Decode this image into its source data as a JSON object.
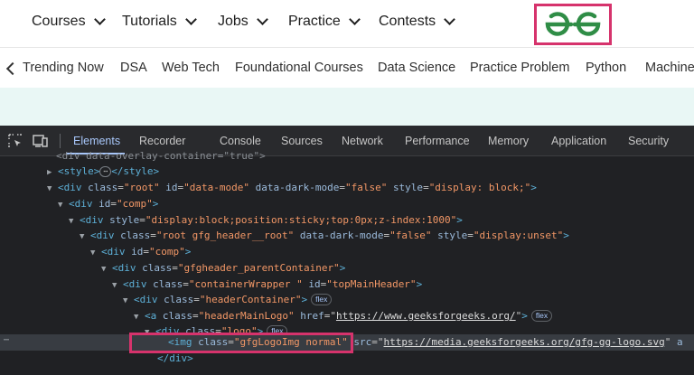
{
  "top_nav": {
    "items": [
      {
        "label": "Courses"
      },
      {
        "label": "Tutorials"
      },
      {
        "label": "Jobs"
      },
      {
        "label": "Practice"
      },
      {
        "label": "Contests"
      }
    ],
    "logo_text": "GfG",
    "logo_color": "#2f8d46",
    "highlight_color": "#d6336c"
  },
  "sub_nav": {
    "items": [
      {
        "label": "Trending Now"
      },
      {
        "label": "DSA"
      },
      {
        "label": "Web Tech"
      },
      {
        "label": "Foundational Courses"
      },
      {
        "label": "Data Science"
      },
      {
        "label": "Practice Problem"
      },
      {
        "label": "Python"
      },
      {
        "label": "Machine"
      }
    ]
  },
  "devtools": {
    "tabs": [
      {
        "label": "Elements",
        "active": true
      },
      {
        "label": "Recorder"
      },
      {
        "label": "Console"
      },
      {
        "label": "Sources"
      },
      {
        "label": "Network"
      },
      {
        "label": "Performance"
      },
      {
        "label": "Memory"
      },
      {
        "label": "Application"
      },
      {
        "label": "Security"
      }
    ],
    "lines": {
      "l0": "<div data-overlay-container=\"true\">",
      "l1_tag1": "<style>",
      "l1_dots": "⋯",
      "l1_tag2": "</style>",
      "l2_tag": "<div",
      "l2_a1": "class",
      "l2_v1": "\"root\"",
      "l2_a2": "id",
      "l2_v2": "\"data-mode\"",
      "l2_a3": "data-dark-mode",
      "l2_v3": "\"false\"",
      "l2_a4": "style",
      "l2_v4": "\"display: block;\"",
      "l2_end": ">",
      "l3_tag": "<div",
      "l3_a1": "id",
      "l3_v1": "\"comp\"",
      "l3_end": ">",
      "l4_tag": "<div",
      "l4_a1": "style",
      "l4_v1": "\"display:block;position:sticky;top:0px;z-index:1000\"",
      "l4_end": ">",
      "l5_tag": "<div",
      "l5_a1": "class",
      "l5_v1": "\"root gfg_header__root\"",
      "l5_a2": "data-dark-mode",
      "l5_v2": "\"false\"",
      "l5_a3": "style",
      "l5_v3": "\"display:unset\"",
      "l5_end": ">",
      "l6_tag": "<div",
      "l6_a1": "id",
      "l6_v1": "\"comp\"",
      "l6_end": ">",
      "l7_tag": "<div",
      "l7_a1": "class",
      "l7_v1": "\"gfgheader_parentContainer\"",
      "l7_end": ">",
      "l8_tag": "<div",
      "l8_a1": "class",
      "l8_v1": "\"containerWrapper \"",
      "l8_a2": "id",
      "l8_v2": "\"topMainHeader\"",
      "l8_end": ">",
      "l9_tag": "<div",
      "l9_a1": "class",
      "l9_v1": "\"headerContainer\"",
      "l9_end": ">",
      "l9_pill": "flex",
      "l10_tag": "<a",
      "l10_a1": "class",
      "l10_v1": "\"headerMainLogo\"",
      "l10_a2": "href",
      "l10_v2": "https://www.geeksforgeeks.org/",
      "l10_end": ">",
      "l10_pill": "flex",
      "l11_tag": "<div",
      "l11_a1": "class",
      "l11_v1": "\"logo\"",
      "l11_end": ">",
      "l11_pill": "flex",
      "l12_tag": "<img",
      "l12_a1": "class",
      "l12_v1": "\"gfgLogoImg normal\"",
      "l12_a2": "src",
      "l12_v2": "https://media.geeksforgeeks.org/gfg-gg-logo.svg",
      "l12_tail": "a",
      "l12_gutter": "⋯",
      "l13_tag": "</div>"
    },
    "colors": {
      "tag": "#5db0d7",
      "attr_name": "#9bbbdc",
      "attr_value": "#f29766",
      "active_tab": "#a8c7fa"
    }
  }
}
